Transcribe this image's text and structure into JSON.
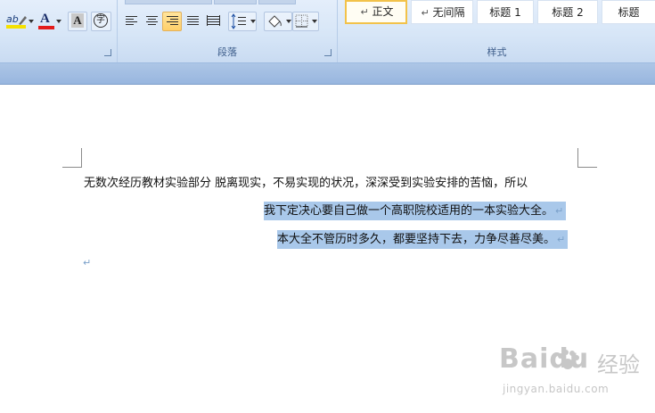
{
  "ribbon": {
    "paragraph_group_label": "段落",
    "styles_group_label": "样式",
    "font_tools": {
      "highlight_icon_text": "ab",
      "font_color_letter": "A",
      "char_shade_letter": "A",
      "enclose_char": "字",
      "highlight_color": "#f5e100",
      "font_color_bar": "#e31b1b"
    },
    "styles": [
      {
        "label": "正文",
        "mark": "↵",
        "active": true
      },
      {
        "label": "无间隔",
        "mark": "↵",
        "active": false
      },
      {
        "label": "标题 1",
        "mark": "",
        "active": false
      },
      {
        "label": "标题 2",
        "mark": "",
        "active": false
      },
      {
        "label": "标题",
        "mark": "",
        "active": false
      }
    ]
  },
  "document": {
    "lines": [
      {
        "text": "无数次经历教材实验部分    脱离现实，不易实现的状况，深深受到实验安排的苦恼，所以",
        "selected": false,
        "mark": ""
      },
      {
        "text": "我下定决心要自己做一个高职院校适用的一本实验大全。",
        "selected": true,
        "mark": "↵"
      },
      {
        "text": "本大全不管历时多久，都要坚持下去，力争尽善尽美。",
        "selected": true,
        "mark": "↵"
      }
    ],
    "empty_paragraph_mark": "↵",
    "selection_color": "#a9c8ea"
  },
  "watermark": {
    "brand": "Baidu",
    "cn": "经验",
    "url": "jingyan.baidu.com"
  }
}
